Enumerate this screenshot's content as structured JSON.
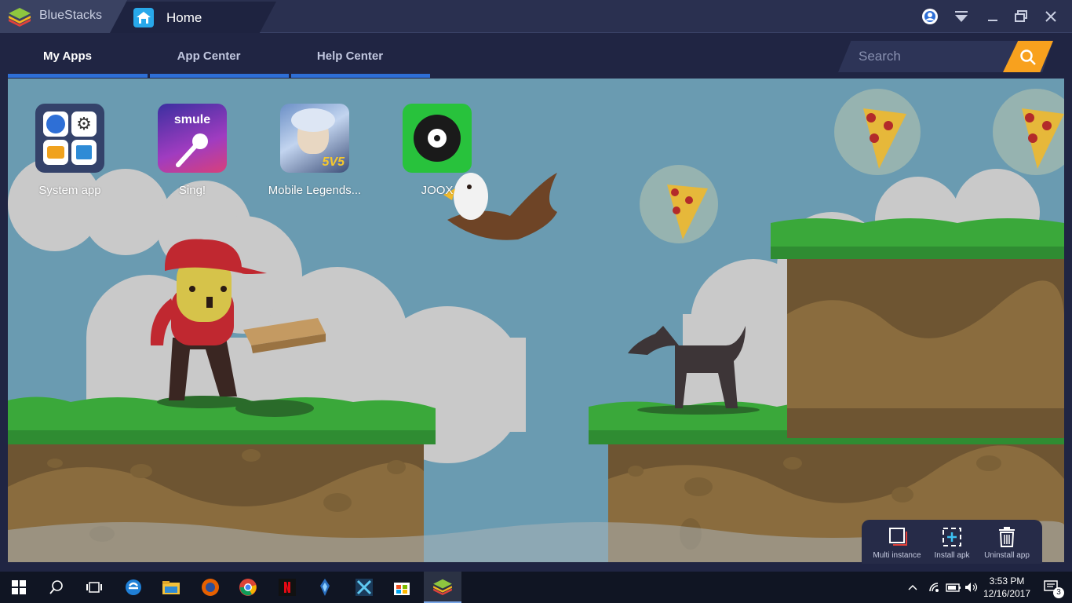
{
  "window": {
    "app_title": "BlueStacks",
    "tab_title": "Home"
  },
  "nav": {
    "tabs": [
      {
        "label": "My Apps",
        "active": true
      },
      {
        "label": "App Center",
        "active": false
      },
      {
        "label": "Help Center",
        "active": false
      }
    ],
    "search_placeholder": "Search"
  },
  "apps": [
    {
      "label": "System app"
    },
    {
      "label": "Sing!",
      "brand_text": "smule"
    },
    {
      "label": "Mobile Legends...",
      "badge_text": "5V5"
    },
    {
      "label": "JOOX"
    }
  ],
  "tools": [
    {
      "label": "Multi instance",
      "icon": "multi-instance-icon"
    },
    {
      "label": "Install apk",
      "icon": "install-apk-icon"
    },
    {
      "label": "Uninstall app",
      "icon": "trash-icon"
    }
  ],
  "taskbar": {
    "time": "3:53 PM",
    "date": "12/16/2017",
    "notification_count": "3"
  },
  "colors": {
    "accent_blue": "#2e6fd6",
    "search_button": "#f8a11e",
    "sky": "#6a9bb1",
    "grass": "#3aa83a",
    "dirt": "#6e5532"
  }
}
